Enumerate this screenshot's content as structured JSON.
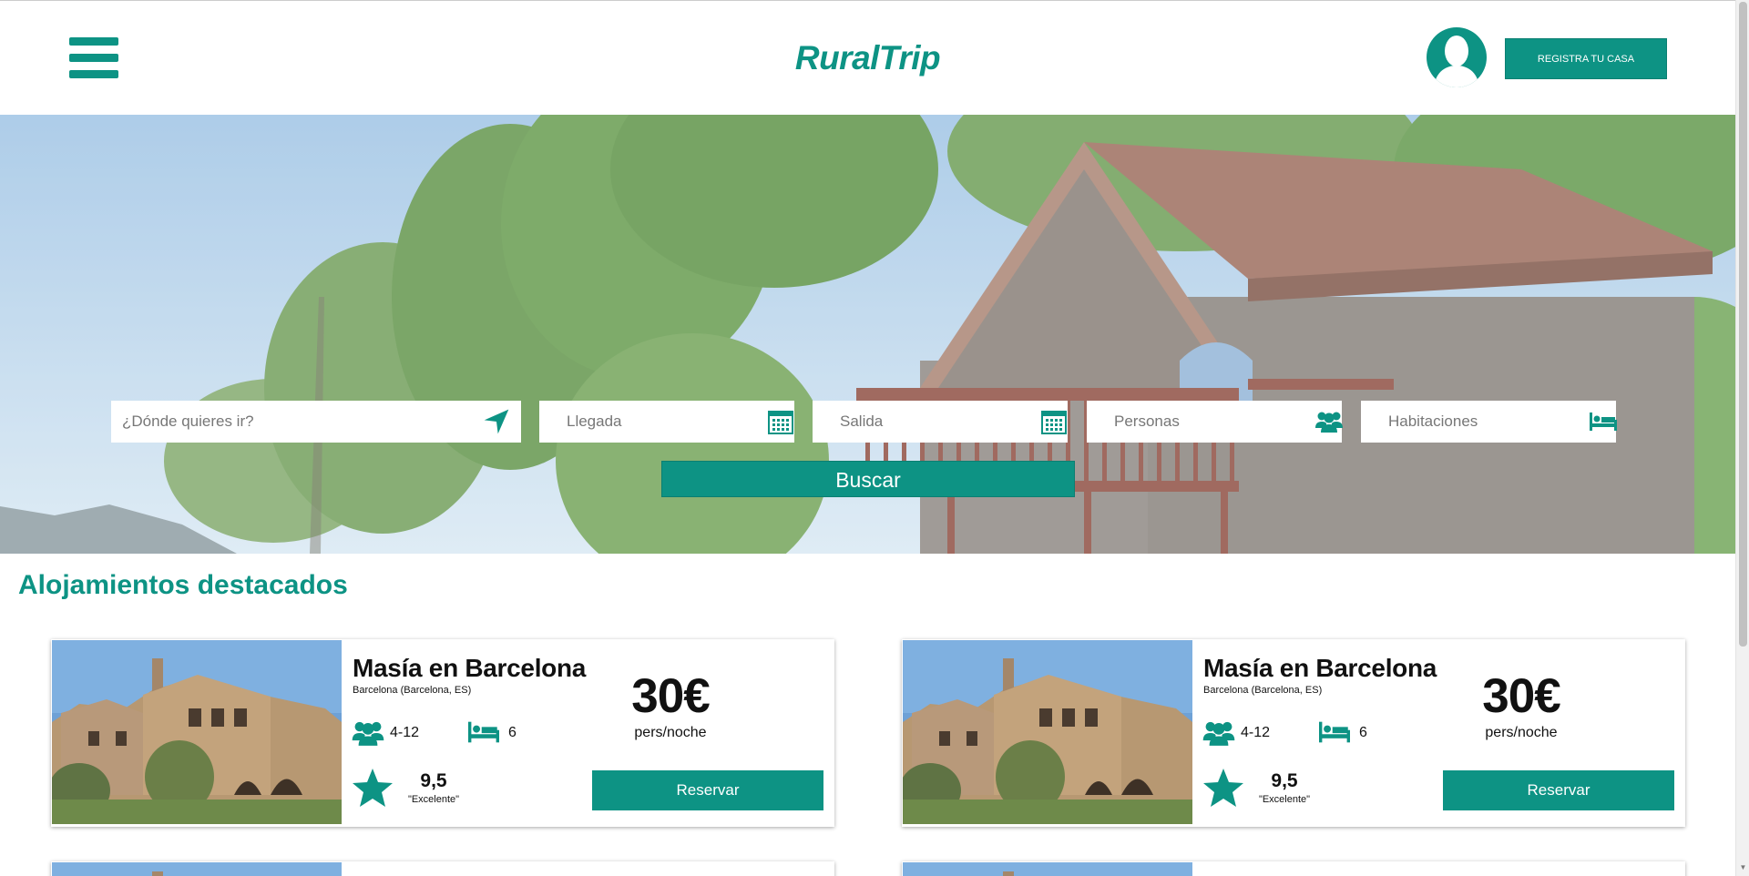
{
  "header": {
    "brand": "RuralTrip",
    "register_label": "REGISTRA TU CASA"
  },
  "search": {
    "destination_placeholder": "¿Dónde quieres ir?",
    "arrival_placeholder": "Llegada",
    "departure_placeholder": "Salida",
    "people_placeholder": "Personas",
    "rooms_placeholder": "Habitaciones",
    "submit_label": "Buscar"
  },
  "featured": {
    "title": "Alojamientos destacados",
    "cards": [
      {
        "title": "Masía en Barcelona",
        "location": "Barcelona (Barcelona, ES)",
        "guests": "4-12",
        "beds": "6",
        "score": "9,5",
        "score_label": "\"Excelente\"",
        "price": "30€",
        "price_unit": "pers/noche",
        "reserve_label": "Reservar"
      },
      {
        "title": "Masía en Barcelona",
        "location": "Barcelona (Barcelona, ES)",
        "guests": "4-12",
        "beds": "6",
        "score": "9,5",
        "score_label": "\"Excelente\"",
        "price": "30€",
        "price_unit": "pers/noche",
        "reserve_label": "Reservar"
      }
    ]
  },
  "colors": {
    "accent": "#0d9384",
    "text": "#111111"
  },
  "icons": [
    "hamburger-menu-icon",
    "user-avatar-icon",
    "location-arrow-icon",
    "calendar-icon",
    "users-icon",
    "bed-icon",
    "star-icon"
  ]
}
